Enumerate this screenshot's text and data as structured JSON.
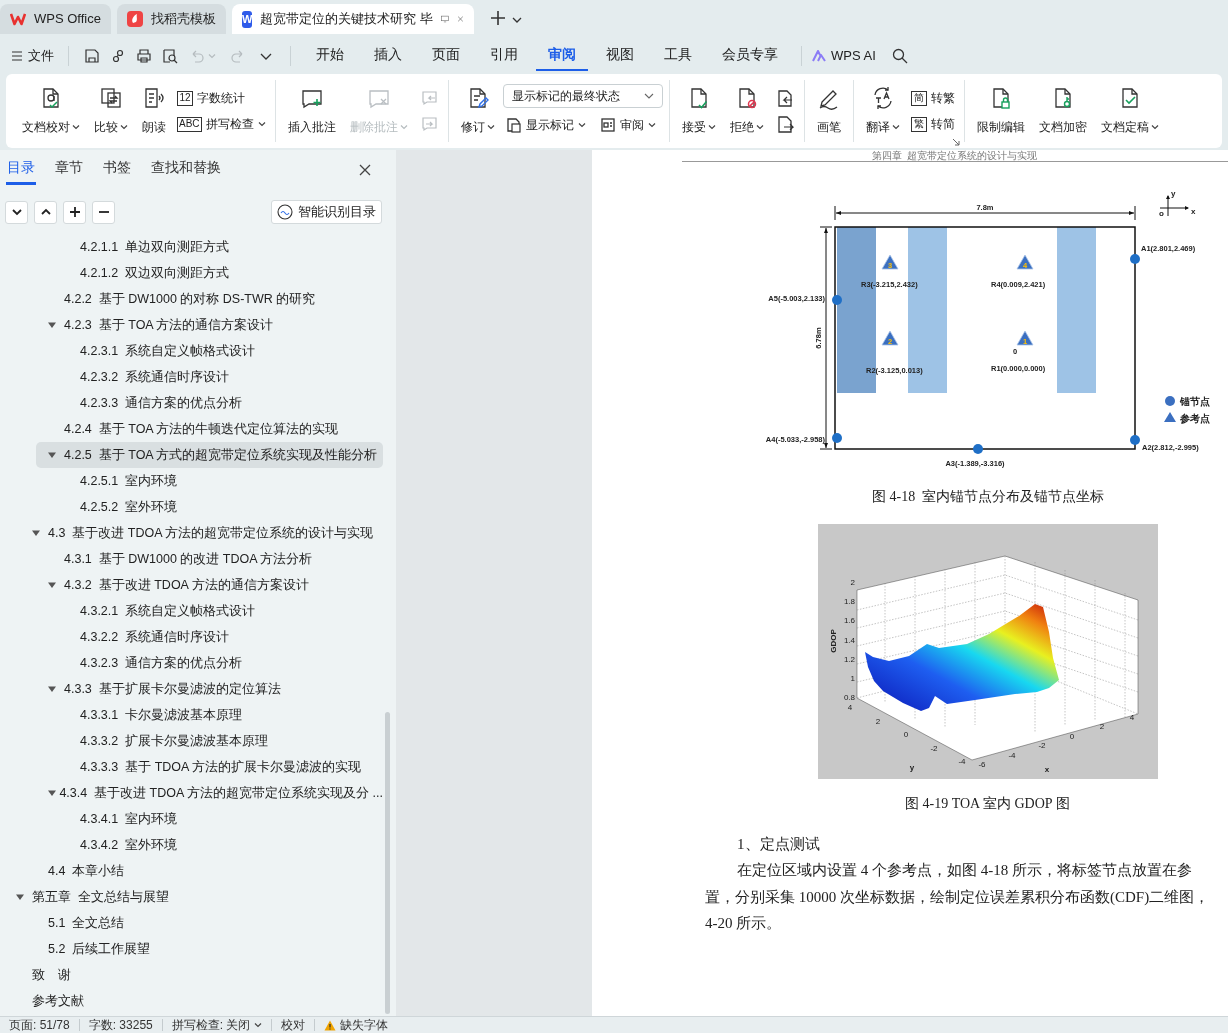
{
  "title_bar": {
    "tabs": [
      {
        "label": "WPS Office",
        "selected": false,
        "kind": "home"
      },
      {
        "label": "找稻壳模板",
        "selected": false,
        "kind": "template"
      },
      {
        "label": "超宽带定位的关键技术研究 毕",
        "selected": true,
        "kind": "document",
        "glyph": "W"
      }
    ]
  },
  "menu_bar": {
    "file": "文件",
    "undo": {
      "disabled": true
    },
    "redo": {
      "disabled": true
    },
    "tabs": [
      {
        "label": "开始",
        "selected": false
      },
      {
        "label": "插入",
        "selected": false
      },
      {
        "label": "页面",
        "selected": false
      },
      {
        "label": "引用",
        "selected": false
      },
      {
        "label": "审阅",
        "selected": true
      },
      {
        "label": "视图",
        "selected": false
      },
      {
        "label": "工具",
        "selected": false
      },
      {
        "label": "会员专享",
        "selected": false
      }
    ],
    "ai": "WPS AI"
  },
  "ribbon": {
    "groups": [
      {
        "items": [
          {
            "kind": "large",
            "label": "文档校对",
            "dropdown": true,
            "disabled": false
          },
          {
            "kind": "large",
            "label": "比较",
            "dropdown": true,
            "disabled": false
          },
          {
            "kind": "large",
            "label": "朗读",
            "dropdown": false,
            "disabled": false
          },
          {
            "kind": "stack",
            "items": [
              {
                "kind": "small",
                "label": "字数统计",
                "glyph": "12",
                "dropdown": false,
                "disabled": false
              },
              {
                "kind": "small",
                "label": "拼写检查",
                "glyph": "ABC",
                "dropdown": true,
                "disabled": false
              }
            ]
          }
        ]
      },
      {
        "items": [
          {
            "kind": "large",
            "label": "插入批注",
            "dropdown": false,
            "disabled": false
          },
          {
            "kind": "large",
            "label": "删除批注",
            "dropdown": true,
            "disabled": true
          },
          {
            "kind": "stack",
            "items": [
              {
                "kind": "icon",
                "disabled": true
              },
              {
                "kind": "icon",
                "disabled": true
              }
            ]
          }
        ]
      },
      {
        "items": [
          {
            "kind": "large",
            "label": "修订",
            "dropdown": true,
            "disabled": false
          },
          {
            "kind": "stack",
            "items": [
              {
                "kind": "select",
                "value": "显示标记的最终状态"
              },
              {
                "kind": "row",
                "items": [
                  {
                    "kind": "small",
                    "label": "显示标记",
                    "dropdown": true,
                    "disabled": false
                  },
                  {
                    "kind": "small",
                    "label": "审阅",
                    "dropdown": true,
                    "disabled": false
                  }
                ]
              }
            ]
          }
        ]
      },
      {
        "items": [
          {
            "kind": "large",
            "label": "接受",
            "dropdown": true,
            "disabled": false
          },
          {
            "kind": "large",
            "label": "拒绝",
            "dropdown": true,
            "disabled": false
          },
          {
            "kind": "stack",
            "items": [
              {
                "kind": "icon",
                "disabled": false
              },
              {
                "kind": "icon",
                "disabled": false
              }
            ]
          }
        ]
      },
      {
        "items": [
          {
            "kind": "large",
            "label": "画笔",
            "dropdown": false,
            "disabled": false
          }
        ]
      },
      {
        "items": [
          {
            "kind": "large",
            "label": "翻译",
            "dropdown": true,
            "disabled": false
          },
          {
            "kind": "stack",
            "items": [
              {
                "kind": "small",
                "label": "转繁",
                "glyph": "简",
                "dropdown": false,
                "disabled": false
              },
              {
                "kind": "small",
                "label": "转简",
                "glyph": "繁",
                "dropdown": false,
                "disabled": false
              }
            ]
          }
        ],
        "launcher": true
      },
      {
        "items": [
          {
            "kind": "large",
            "label": "限制编辑",
            "dropdown": false,
            "disabled": false
          },
          {
            "kind": "large",
            "label": "文档加密",
            "dropdown": false,
            "disabled": false
          },
          {
            "kind": "large",
            "label": "文档定稿",
            "dropdown": true,
            "disabled": false
          }
        ]
      }
    ]
  },
  "sidebar": {
    "tabs": [
      {
        "label": "目录",
        "selected": true
      },
      {
        "label": "章节",
        "selected": false
      },
      {
        "label": "书签",
        "selected": false
      },
      {
        "label": "查找和替换",
        "selected": false
      }
    ],
    "smart_button": "智能识别目录",
    "toc": [
      {
        "children": [
          {
            "children": [
              {
                "children": [
                  {
                    "label": "4.2.1.1  单边双向测距方式",
                    "selected": false
                  },
                  {
                    "label": "4.2.1.2  双边双向测距方式",
                    "selected": false
                  }
                ]
              },
              {
                "label": "4.2.2  基于 DW1000 的对称 DS-TWR 的研究",
                "selected": false
              },
              {
                "label": "4.2.3  基于 TOA 方法的通信方案设计",
                "selected": false,
                "expanded": true,
                "children": [
                  {
                    "label": "4.2.3.1  系统自定义帧格式设计",
                    "selected": false
                  },
                  {
                    "label": "4.2.3.2  系统通信时序设计",
                    "selected": false
                  },
                  {
                    "label": "4.2.3.3  通信方案的优点分析",
                    "selected": false
                  }
                ]
              },
              {
                "label": "4.2.4  基于 TOA 方法的牛顿迭代定位算法的实现",
                "selected": false
              },
              {
                "label": "4.2.5  基于 TOA 方式的超宽带定位系统实现及性能分析",
                "selected": true,
                "expanded": true,
                "children": [
                  {
                    "label": "4.2.5.1  室内环境",
                    "selected": false
                  },
                  {
                    "label": "4.2.5.2  室外环境",
                    "selected": false
                  }
                ]
              }
            ]
          },
          {
            "label": "4.3  基于改进 TDOA 方法的超宽带定位系统的设计与实现",
            "selected": false,
            "expanded": true,
            "children": [
              {
                "label": "4.3.1  基于 DW1000 的改进 TDOA 方法分析",
                "selected": false
              },
              {
                "label": "4.3.2  基于改进 TDOA 方法的通信方案设计",
                "selected": false,
                "expanded": true,
                "children": [
                  {
                    "label": "4.3.2.1  系统自定义帧格式设计",
                    "selected": false
                  },
                  {
                    "label": "4.3.2.2  系统通信时序设计",
                    "selected": false
                  },
                  {
                    "label": "4.3.2.3  通信方案的优点分析",
                    "selected": false
                  }
                ]
              },
              {
                "label": "4.3.3  基于扩展卡尔曼滤波的定位算法",
                "selected": false,
                "expanded": true,
                "children": [
                  {
                    "label": "4.3.3.1  卡尔曼滤波基本原理",
                    "selected": false
                  },
                  {
                    "label": "4.3.3.2  扩展卡尔曼滤波基本原理",
                    "selected": false
                  },
                  {
                    "label": "4.3.3.3  基于 TDOA 方法的扩展卡尔曼滤波的实现",
                    "selected": false
                  }
                ]
              },
              {
                "label": "4.3.4  基于改进 TDOA 方法的超宽带定位系统实现及分 ...",
                "selected": false,
                "expanded": true,
                "children": [
                  {
                    "label": "4.3.4.1  室内环境",
                    "selected": false
                  },
                  {
                    "label": "4.3.4.2  室外环境",
                    "selected": false
                  }
                ]
              }
            ]
          },
          {
            "label": "4.4  本章小结",
            "selected": false
          }
        ]
      },
      {
        "label": "第五章  全文总结与展望",
        "selected": false,
        "expanded": true,
        "children": [
          {
            "label": "5.1  全文总结",
            "selected": false
          },
          {
            "label": "5.2  后续工作展望",
            "selected": false
          }
        ]
      },
      {
        "label": "致　谢",
        "selected": false
      },
      {
        "label": "参考文献",
        "selected": false
      }
    ]
  },
  "document": {
    "header": "第四章  超宽带定位系统的设计与实现",
    "figure_1": {
      "width_label": "7.8m",
      "height_label": "6.78m",
      "axis_x": "x",
      "axis_y": "y",
      "axis_origin": "o",
      "origin_label": "0",
      "anchors": [
        {
          "label": "A1(2.801,2.469)"
        },
        {
          "label": "A5(-5.003,2.133)"
        },
        {
          "label": "A4(-5.033,-2.958)"
        },
        {
          "label": "A2(2.812,-2.995)"
        },
        {
          "label": "A3(-1.389,-3.316)"
        }
      ],
      "references": [
        {
          "number": "3",
          "label": "R3(-3.215,2.432)"
        },
        {
          "number": "4",
          "label": "R4(0.009,2.421)"
        },
        {
          "number": "2",
          "label": "R2(-3.125,0.013)"
        },
        {
          "number": "1",
          "label": "R1(0.000,0.000)"
        }
      ],
      "legend": [
        {
          "kind": "anchor",
          "label": "锚节点"
        },
        {
          "kind": "reference",
          "label": "参考点"
        }
      ],
      "caption": "图 4-18  室内锚节点分布及锚节点坐标"
    },
    "figure_2": {
      "zlabel": "GDOP",
      "xlabel": "x",
      "ylabel": "y",
      "zticks": [
        "2",
        "1.8",
        "1.6",
        "1.4",
        "1.2",
        "1",
        "0.8"
      ],
      "yticks": [
        "4",
        "2",
        "0",
        "-2",
        "-4"
      ],
      "xticks": [
        "-6",
        "-4",
        "-2",
        "0",
        "2",
        "4"
      ],
      "caption": "图 4-19 TOA 室内 GDOP 图"
    },
    "heading": "1、定点测试",
    "paragraph_lines": [
      "在定位区域内设置 4 个参考点，如图 4-18 所示，将标签节点放置在参",
      "置，分别采集 10000 次坐标数据，绘制定位误差累积分布函数(CDF)二维图，",
      "4-20 所示。"
    ]
  },
  "status_bar": [
    {
      "kind": "text",
      "label": "页面: 51/78"
    },
    {
      "kind": "text",
      "label": "字数: 33255"
    },
    {
      "kind": "dropdown",
      "label": "拼写检查: 关闭"
    },
    {
      "kind": "text",
      "label": "校对"
    },
    {
      "kind": "warning",
      "label": "缺失字体"
    }
  ]
}
